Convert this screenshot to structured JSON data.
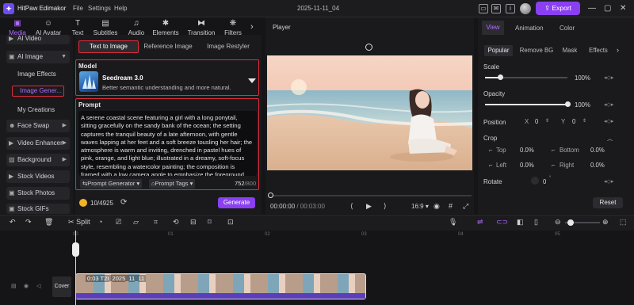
{
  "app": {
    "name": "HitPaw Edimakor",
    "project": "2025-11-11_04"
  },
  "menu": [
    "File",
    "Settings",
    "Help"
  ],
  "header": {
    "export_label": "Export"
  },
  "tool_tabs": [
    "Media",
    "AI Avatar",
    "Text",
    "Subtitles",
    "Audio",
    "Elements",
    "Transition",
    "Filters"
  ],
  "sidebar": {
    "ai_video": "AI Video",
    "ai_image": "AI Image",
    "image_effects": "Image Effects",
    "image_generator": "Image Gener...",
    "my_creations": "My Creations",
    "face_swap": "Face Swap",
    "video_enhancer": "Video Enhancer",
    "background": "Background",
    "stock_videos": "Stock Videos",
    "stock_photos": "Stock Photos",
    "stock_gifs": "Stock GIFs"
  },
  "generator": {
    "tabs": [
      "Text to Image",
      "Reference Image",
      "Image Restyler"
    ],
    "model_label": "Model",
    "model_name": "Seedream 3.0",
    "model_desc": "Better semantic understanding and more natural.",
    "prompt_label": "Prompt",
    "prompt_text": "A serene coastal scene featuring a girl with a long ponytail, sitting gracefully on the sandy bank of the ocean; the setting captures the tranquil beauty of a late afternoon, with gentle waves lapping at her feet and a soft breeze tousling her hair; the atmosphere is warm and inviting, drenched in pastel hues of pink, orange, and light blue; illustrated in a dreamy, soft-focus style, resembling a watercolor painting; the composition is framed with a low camera angle to emphasize the foreground,",
    "prompt_generator": "Prompt Generator",
    "prompt_tags": "Prompt Tags",
    "char_count": "752",
    "char_max": "/800",
    "credits": "10/4925",
    "generate_label": "Generate"
  },
  "player": {
    "title": "Player",
    "time_current": "00:00:00",
    "time_total": " / 00:03:00",
    "ratio": "16:9"
  },
  "right_panel": {
    "tabs": [
      "View",
      "Animation",
      "Color"
    ],
    "subtabs": [
      "Popular",
      "Remove BG",
      "Mask",
      "Effects"
    ],
    "scale_label": "Scale",
    "scale_value": "100%",
    "scale_level": 1.0,
    "opacity_label": "Opacity",
    "opacity_value": "100%",
    "opacity_level": 1.0,
    "position_label": "Position",
    "pos_x_label": "X",
    "pos_x": "0",
    "pos_y_label": "Y",
    "pos_y": "0",
    "crop_label": "Crop",
    "crop_top_label": "Top",
    "crop_top": "0.0%",
    "crop_bottom_label": "Bottom",
    "crop_bottom": "0.0%",
    "crop_left_label": "Left",
    "crop_left": "0.0%",
    "crop_right_label": "Right",
    "crop_right": "0.0%",
    "rotate_label": "Rotate",
    "rotate_value": "0",
    "reset_label": "Reset"
  },
  "timeline": {
    "split_label": "Split",
    "ruler": [
      "00",
      "01",
      "02",
      "03",
      "04",
      "05"
    ],
    "cover_label": "Cover",
    "clip_label": "0:03 T2I_2025_11_11"
  },
  "colors": {
    "accent": "#8a3ff2",
    "highlight_box": "#e02b3c",
    "bg": "#151517",
    "panel": "#1a1a1d"
  }
}
